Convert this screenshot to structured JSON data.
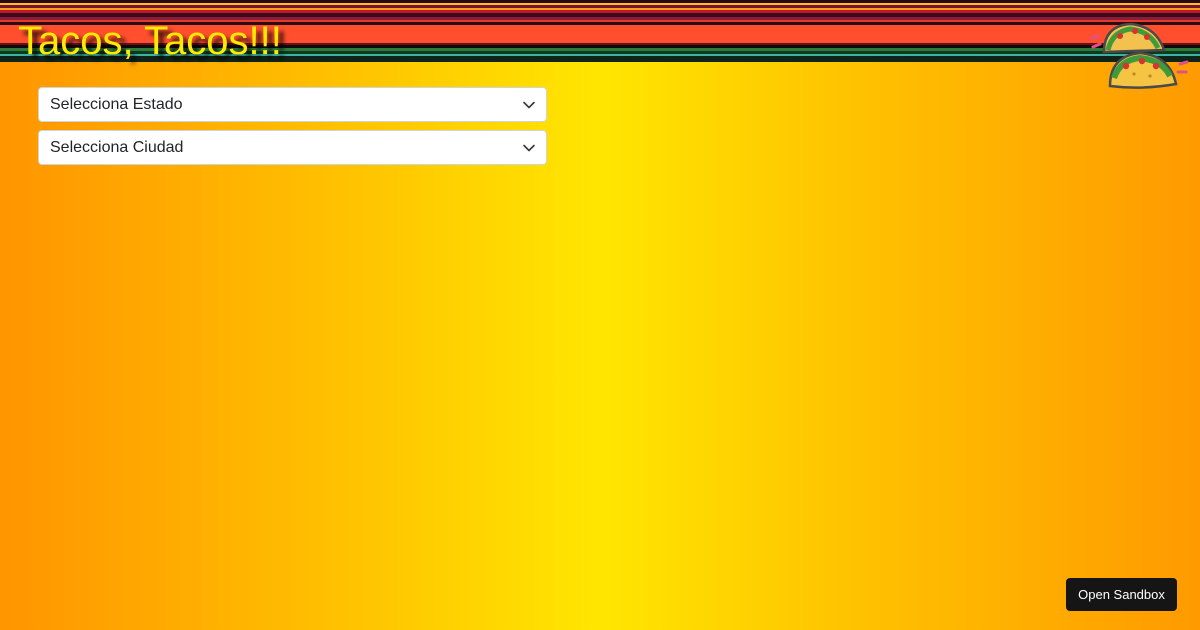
{
  "header": {
    "title": "Tacos, Tacos!!!",
    "logo_icon": "tacos-logo-icon"
  },
  "filters": {
    "state_select": {
      "selected": "Selecciona Estado"
    },
    "city_select": {
      "selected": "Selecciona Ciudad"
    }
  },
  "footer": {
    "open_sandbox_label": "Open Sandbox"
  },
  "colors": {
    "title": "#ffeb00",
    "banner_main": "#ff4f2e",
    "background_center": "#ffe600",
    "background_edge": "#ff9500",
    "button_bg": "#151515"
  }
}
